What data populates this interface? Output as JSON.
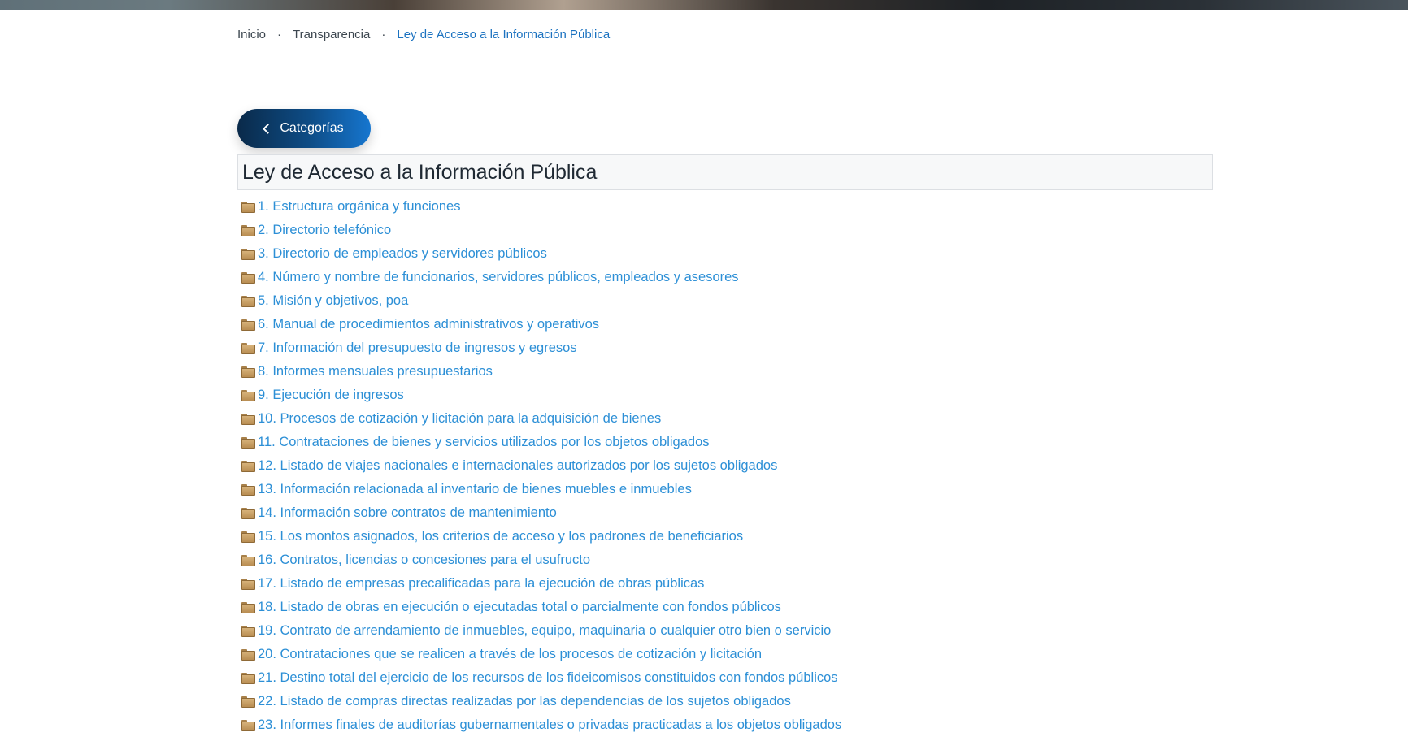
{
  "breadcrumb": {
    "items": [
      "Inicio",
      "Transparencia",
      "Ley de Acceso a la Información Pública"
    ],
    "separator": "·"
  },
  "categories_button": {
    "label": "Categorías",
    "icon": "chevron-left-icon"
  },
  "section": {
    "title": "Ley de Acceso a la Información Pública"
  },
  "documents": {
    "icon": "folder-icon",
    "items": [
      "1. Estructura orgánica y funciones",
      "2. Directorio telefónico",
      "3. Directorio de empleados y servidores públicos",
      "4. Número y nombre de funcionarios, servidores públicos, empleados y asesores",
      "5. Misión y objetivos, poa",
      "6. Manual de procedimientos administrativos y operativos",
      "7. Información del presupuesto de ingresos y egresos",
      "8. Informes mensuales presupuestarios",
      "9. Ejecución de ingresos",
      "10. Procesos de cotización y licitación para la adquisición de bienes",
      "11. Contrataciones de bienes y servicios utilizados por los objetos obligados",
      "12. Listado de viajes nacionales e internacionales autorizados por los sujetos obligados",
      "13. Información relacionada al inventario de bienes muebles e inmuebles",
      "14. Información sobre contratos de mantenimiento",
      "15. Los montos asignados, los criterios de acceso y los padrones de beneficiarios",
      "16. Contratos, licencias o concesiones para el usufructo",
      "17. Listado de empresas precalificadas para la ejecución de obras públicas",
      "18. Listado de obras en ejecución o ejecutadas total o parcialmente con fondos públicos",
      "19. Contrato de arrendamiento de inmuebles, equipo, maquinaria o cualquier otro bien o servicio",
      "20. Contrataciones que se realicen a través de los procesos de cotización y licitación",
      "21. Destino total del ejercicio de los recursos de los fideicomisos constituidos con fondos públicos",
      "22. Listado de compras directas realizadas por las dependencias de los sujetos obligados",
      "23. Informes finales de auditorías gubernamentales o privadas practicadas a los objetos obligados"
    ]
  },
  "colors": {
    "link": "#2c8fd6",
    "breadcrumb_current": "#1b72c0",
    "button_gradient_start": "#0a2a4a",
    "button_gradient_end": "#1676cf"
  }
}
